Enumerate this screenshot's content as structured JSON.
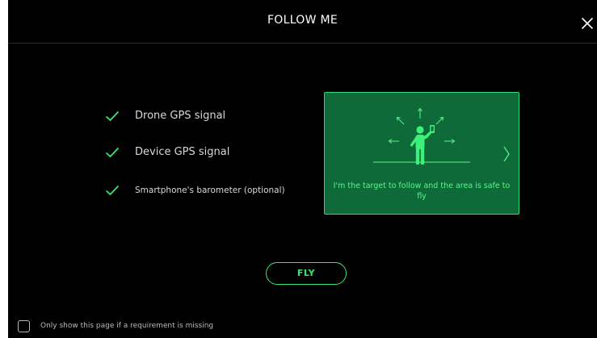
{
  "header": {
    "title": "FOLLOW ME",
    "close_icon": "close-icon"
  },
  "requirements": [
    {
      "label": "Drone GPS signal",
      "status": "ok",
      "icon": "check-icon"
    },
    {
      "label": "Device GPS signal",
      "status": "ok",
      "icon": "check-icon"
    },
    {
      "label": "Smartphone's barometer (optional)",
      "status": "ok",
      "icon": "check-icon"
    }
  ],
  "target_card": {
    "caption": "I'm the target to follow and the area is safe to fly",
    "illustration": "person-holding-phone-icon",
    "next_icon": "chevron-right-icon"
  },
  "actions": {
    "fly_label": "FLY"
  },
  "footer": {
    "checkbox_label": "Only show this page if a requirement is missing",
    "checked": false
  },
  "colors": {
    "background": "#000000",
    "accent": "#36e873",
    "card_fill": "#0e6a38",
    "text": "#d8d8d8"
  }
}
